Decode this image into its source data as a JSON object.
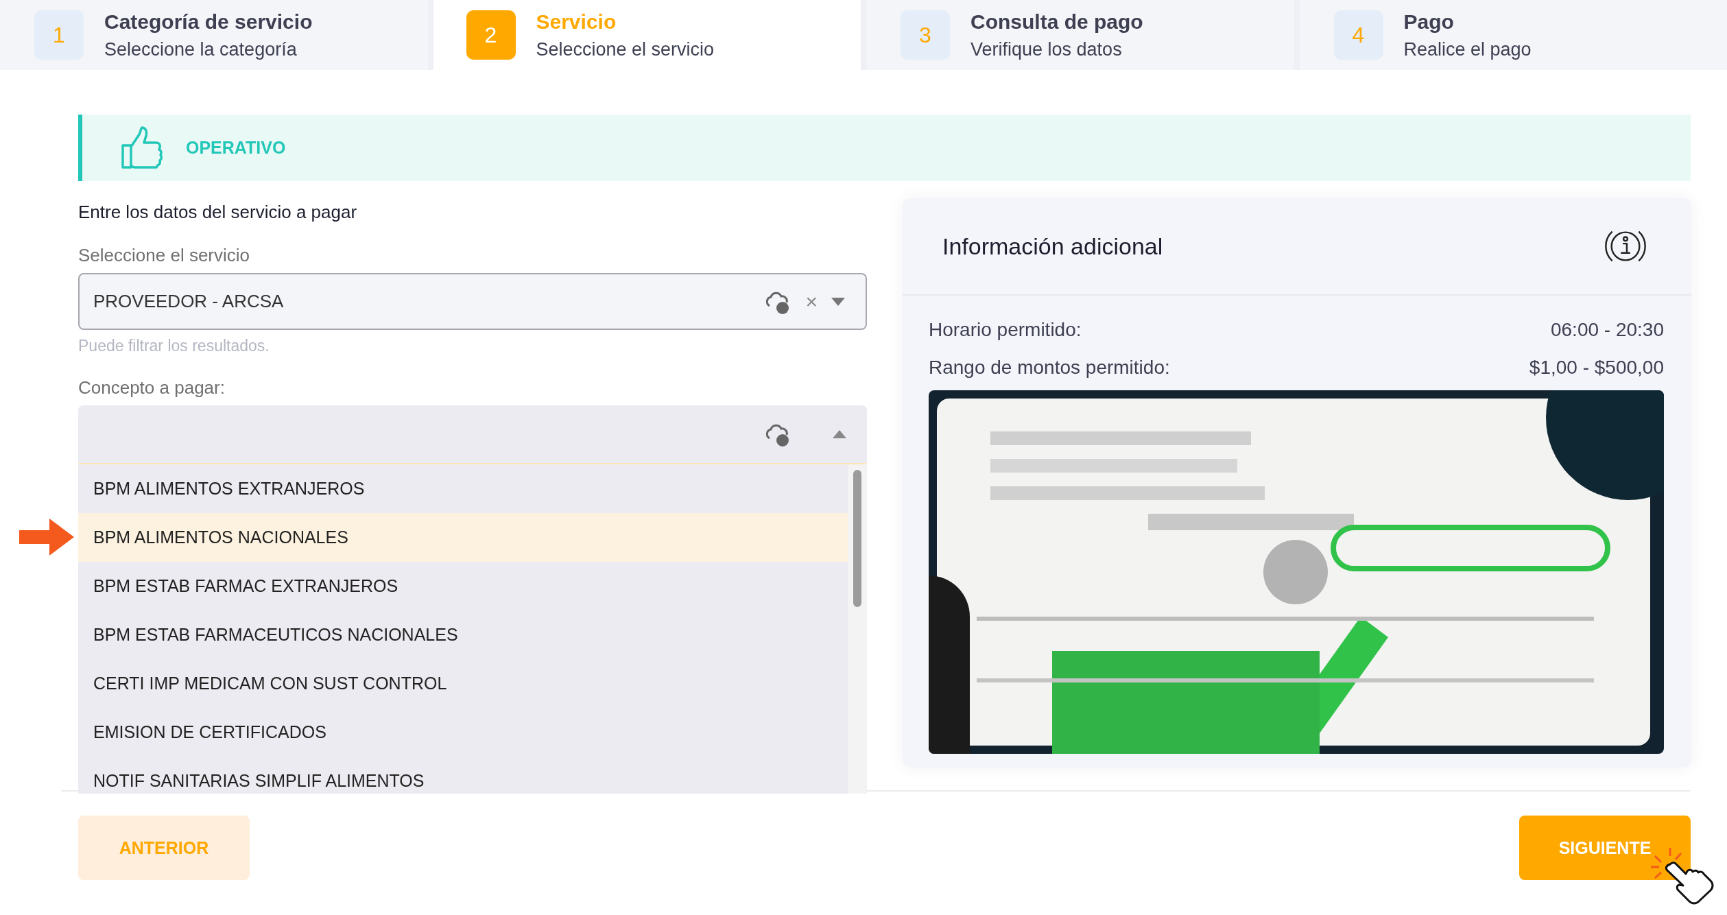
{
  "steps": [
    {
      "number": "1",
      "title": "Categoría de servicio",
      "subtitle": "Seleccione la categoría",
      "selected": false
    },
    {
      "number": "2",
      "title": "Servicio",
      "subtitle": "Seleccione el servicio",
      "selected": true
    },
    {
      "number": "3",
      "title": "Consulta de pago",
      "subtitle": "Verifique los datos",
      "selected": false
    },
    {
      "number": "4",
      "title": "Pago",
      "subtitle": "Realice el pago",
      "selected": false
    }
  ],
  "status_banner": {
    "label": "OPERATIVO"
  },
  "form": {
    "heading": "Entre los datos del servicio a pagar",
    "service_label": "Seleccione el servicio",
    "service_value": "PROVEEDOR - ARCSA",
    "service_clear": "×",
    "service_hint": "Puede filtrar los resultados.",
    "concept_label": "Concepto a pagar:",
    "concept_expanded": true,
    "concept_options": [
      {
        "label": "BPM ALIMENTOS EXTRANJEROS",
        "selected": false
      },
      {
        "label": "BPM ALIMENTOS NACIONALES",
        "selected": true
      },
      {
        "label": "BPM ESTAB FARMAC EXTRANJEROS",
        "selected": false
      },
      {
        "label": "BPM ESTAB FARMACEUTICOS NACIONALES",
        "selected": false
      },
      {
        "label": "CERTI IMP MEDICAM CON SUST CONTROL",
        "selected": false
      },
      {
        "label": "EMISION DE CERTIFICADOS",
        "selected": false
      },
      {
        "label": "NOTIF SANITARIAS SIMPLIF ALIMENTOS",
        "selected": false
      }
    ]
  },
  "info_panel": {
    "title": "Información adicional",
    "rows": [
      {
        "label": "Horario permitido:",
        "value": "06:00 - 20:30"
      },
      {
        "label": "Rango de montos permitido:",
        "value": "$1,00 - $500,00"
      }
    ]
  },
  "buttons": {
    "back": "ANTERIOR",
    "next": "SIGUIENTE"
  }
}
